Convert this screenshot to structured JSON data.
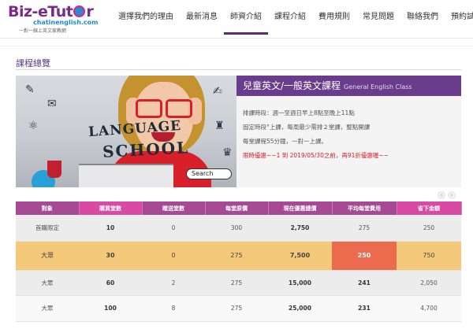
{
  "logo": {
    "main_left": "Biz-eTut",
    "main_right": "r",
    "sub": "chatinenglish.com",
    "tagline": "一對一線上英文家教網"
  },
  "nav": {
    "items": [
      {
        "label": "選擇我們的理由"
      },
      {
        "label": "最新消息"
      },
      {
        "label": "師資介紹"
      },
      {
        "label": "課程介紹"
      },
      {
        "label": "費用規則"
      },
      {
        "label": "常見問題"
      },
      {
        "label": "聯絡我們"
      },
      {
        "label": "預約試聽"
      }
    ],
    "active_index": 2
  },
  "section": {
    "title": "課程總覽"
  },
  "banner": {
    "word1": "LANGUAGE",
    "word2": "SCHOOL",
    "search_label": "Search"
  },
  "course": {
    "title": "兒童英文/一般英文課程",
    "title_en": "General English Class",
    "lines": [
      "排課時段：週一至週日早上8點至晚上11點",
      "固定時段°上課，每周最少需排２堂課，整點開課",
      "每堂課程55分鐘，一對一上課。",
      "限時優惠~~1 到 2019/05/30之前，再91折優惠喔~~"
    ]
  },
  "pricing": {
    "headers": [
      "對象",
      "購買堂數",
      "贈送堂數",
      "每堂原價",
      "現在優惠總價",
      "平均每堂費用",
      "省下金額"
    ],
    "rows": [
      [
        "首購限定",
        "10",
        "0",
        "300",
        "2,750",
        "275",
        "250"
      ],
      [
        "大眾",
        "30",
        "0",
        "275",
        "7,500",
        "250",
        "750"
      ],
      [
        "大眾",
        "60",
        "2",
        "275",
        "15,000",
        "241",
        "2,050"
      ],
      [
        "大眾",
        "100",
        "8",
        "275",
        "25,000",
        "231",
        "4,700"
      ]
    ]
  },
  "colors": {
    "brand": "#6a3c8c",
    "table_header": "#a64a96",
    "highlight_row": "#f5c97a",
    "highlight_cell": "#ec6a4e"
  }
}
